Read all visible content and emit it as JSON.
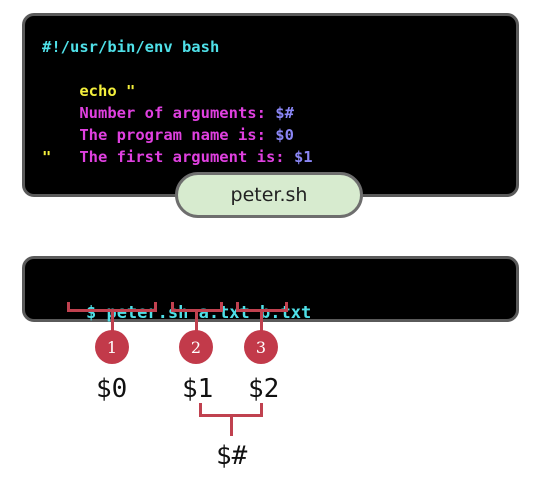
{
  "script": {
    "line1": "#!/usr/bin/env bash",
    "line2_cmd": "echo",
    "line2_quote": "\"",
    "line3_text": "Number of arguments: ",
    "line3_var": "$#",
    "line4_text": "The program name is: ",
    "line4_var": "$0",
    "line5_text": "The first argument is: ",
    "line5_var": "$1",
    "line6": "\"",
    "filename": "peter.sh"
  },
  "command": {
    "prompt": "$",
    "program": "peter.sh",
    "arg1": "a.txt",
    "arg2": "b.txt"
  },
  "markers": [
    "1",
    "2",
    "3"
  ],
  "labels": {
    "program_var": "$0",
    "arg1_var": "$1",
    "arg2_var": "$2",
    "count_var": "$#"
  },
  "colors": {
    "terminal_bg": "#000000",
    "accent_red": "#c23a4a",
    "tab_green": "#d7ebcf",
    "cyan": "#4fe0e8",
    "magenta": "#e040e0",
    "yellow": "#f3ef3c",
    "violet": "#8a86f5"
  }
}
